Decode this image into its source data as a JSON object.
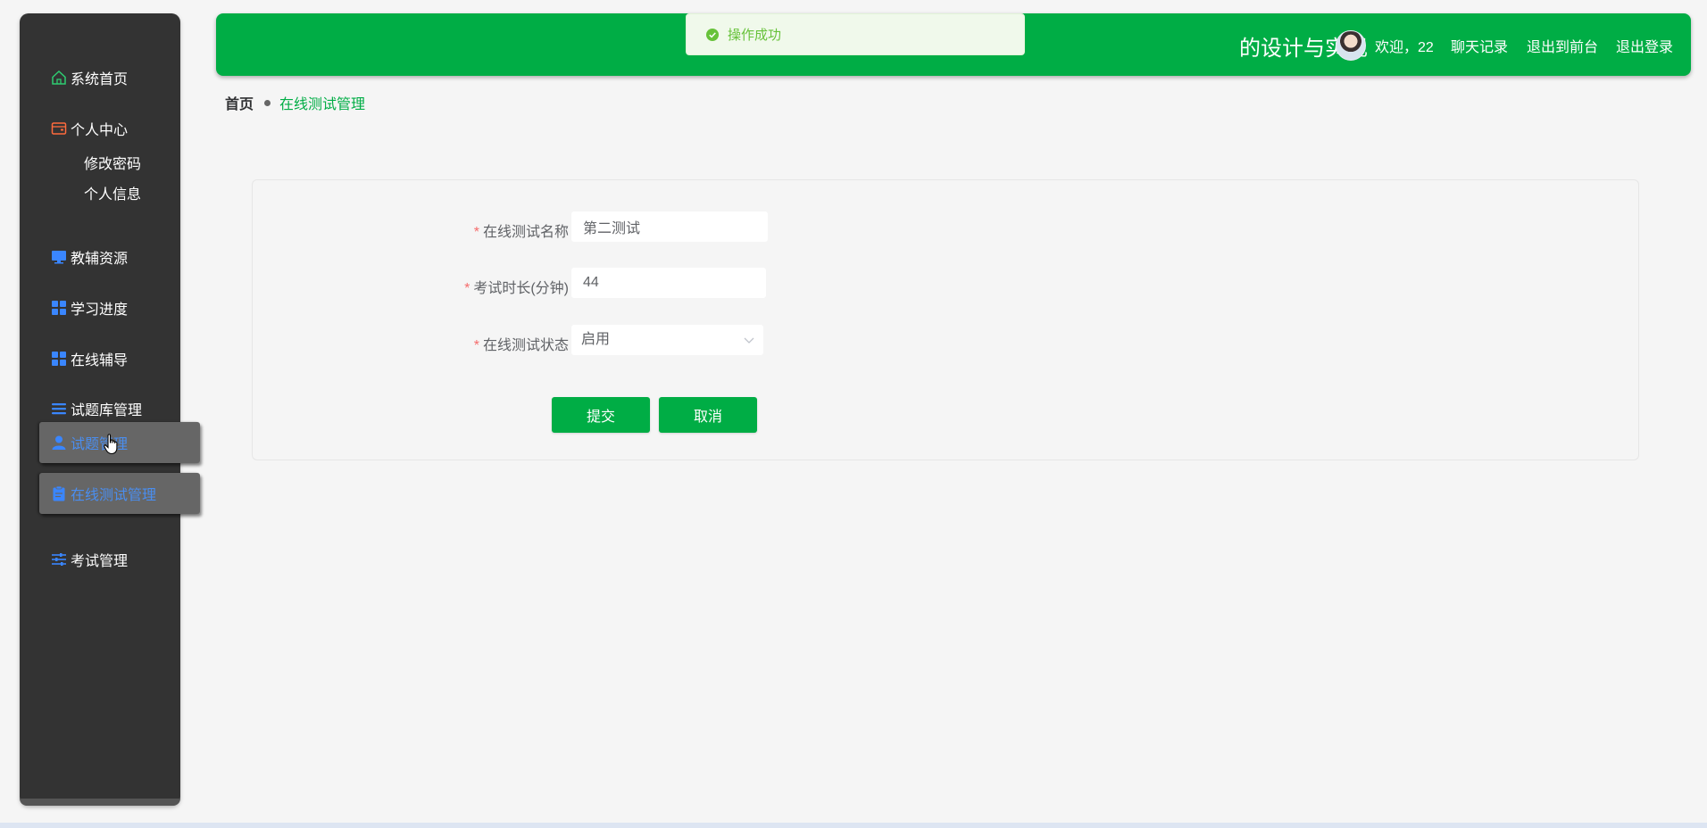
{
  "toast": {
    "message": "操作成功",
    "icon": "check-circle-icon",
    "color": "#67c23a"
  },
  "header": {
    "title": "的设计与实现",
    "welcome": "欢迎，22",
    "chat_record": "聊天记录",
    "exit_front": "退出到前台",
    "logout": "退出登录",
    "bg_color": "#00ad45"
  },
  "sidebar": {
    "items": [
      {
        "label": "系统首页",
        "icon": "home-icon"
      },
      {
        "label": "个人中心",
        "icon": "wallet-icon"
      },
      {
        "label": "教辅资源",
        "icon": "monitor-icon"
      },
      {
        "label": "学习进度",
        "icon": "grid-icon"
      },
      {
        "label": "在线辅导",
        "icon": "grid-icon"
      },
      {
        "label": "试题库管理",
        "icon": "list-icon"
      },
      {
        "label": "试题管理",
        "icon": "user-icon"
      },
      {
        "label": "在线测试管理",
        "icon": "clipboard-icon"
      },
      {
        "label": "考试管理",
        "icon": "sliders-icon"
      }
    ],
    "sub_items": [
      {
        "label": "修改密码"
      },
      {
        "label": "个人信息"
      }
    ]
  },
  "breadcrumb": {
    "home": "首页",
    "current": "在线测试管理"
  },
  "form": {
    "fields": [
      {
        "label": "在线测试名称",
        "value": "第二测试",
        "required": true
      },
      {
        "label": "考试时长(分钟)",
        "value": "44",
        "required": true
      },
      {
        "label": "在线测试状态",
        "value": "启用",
        "required": true
      }
    ],
    "submit_label": "提交",
    "cancel_label": "取消"
  },
  "colors": {
    "primary": "#00ad45",
    "sidebar_bg": "#333333",
    "active_text": "#4a8ef0",
    "required": "#f56c6c"
  }
}
